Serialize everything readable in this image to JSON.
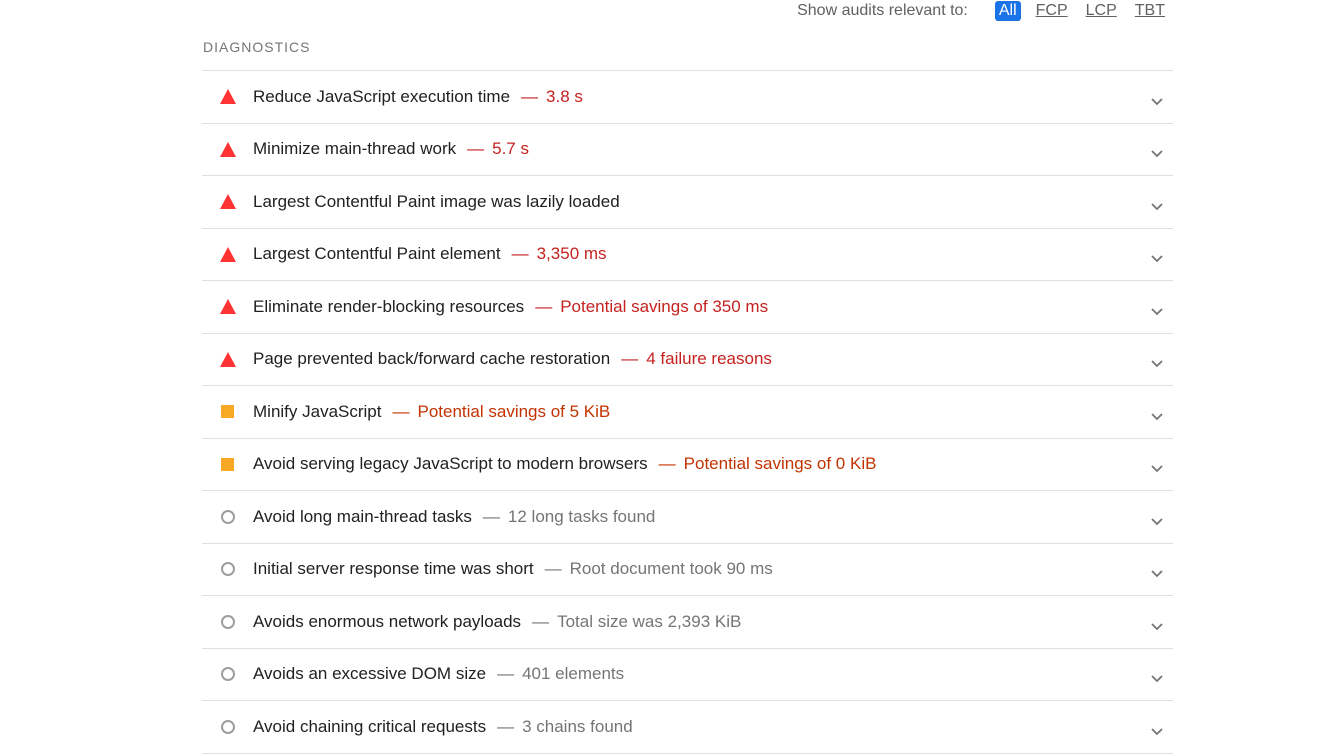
{
  "filter": {
    "label": "Show audits relevant to:",
    "options": [
      "All",
      "FCP",
      "LCP",
      "TBT"
    ],
    "selected": "All"
  },
  "section": {
    "title": "DIAGNOSTICS"
  },
  "colors": {
    "fail": "#c5221f",
    "fail_icon": "#ff3333",
    "average": "#c33300",
    "average_icon": "#f9a825",
    "info": "#757575",
    "accent": "#1a73e8"
  },
  "audits": [
    {
      "status": "fail",
      "title": "Reduce JavaScript execution time",
      "display": "3.8 s"
    },
    {
      "status": "fail",
      "title": "Minimize main-thread work",
      "display": "5.7 s"
    },
    {
      "status": "fail",
      "title": "Largest Contentful Paint image was lazily loaded",
      "display": ""
    },
    {
      "status": "fail",
      "title": "Largest Contentful Paint element",
      "display": "3,350 ms"
    },
    {
      "status": "fail",
      "title": "Eliminate render-blocking resources",
      "display": "Potential savings of 350 ms"
    },
    {
      "status": "fail",
      "title": "Page prevented back/forward cache restoration",
      "display": "4 failure reasons"
    },
    {
      "status": "average",
      "title": "Minify JavaScript",
      "display": "Potential savings of 5 KiB"
    },
    {
      "status": "average",
      "title": "Avoid serving legacy JavaScript to modern browsers",
      "display": "Potential savings of 0 KiB"
    },
    {
      "status": "info",
      "title": "Avoid long main-thread tasks",
      "display": "12 long tasks found"
    },
    {
      "status": "info",
      "title": "Initial server response time was short",
      "display": "Root document took 90 ms"
    },
    {
      "status": "info",
      "title": "Avoids enormous network payloads",
      "display": "Total size was 2,393 KiB"
    },
    {
      "status": "info",
      "title": "Avoids an excessive DOM size",
      "display": "401 elements"
    },
    {
      "status": "info",
      "title": "Avoid chaining critical requests",
      "display": "3 chains found"
    }
  ],
  "icons": {
    "fail": "triangle-warning-icon",
    "average": "square-average-icon",
    "info": "circle-info-icon",
    "expand": "chevron-down-icon"
  }
}
